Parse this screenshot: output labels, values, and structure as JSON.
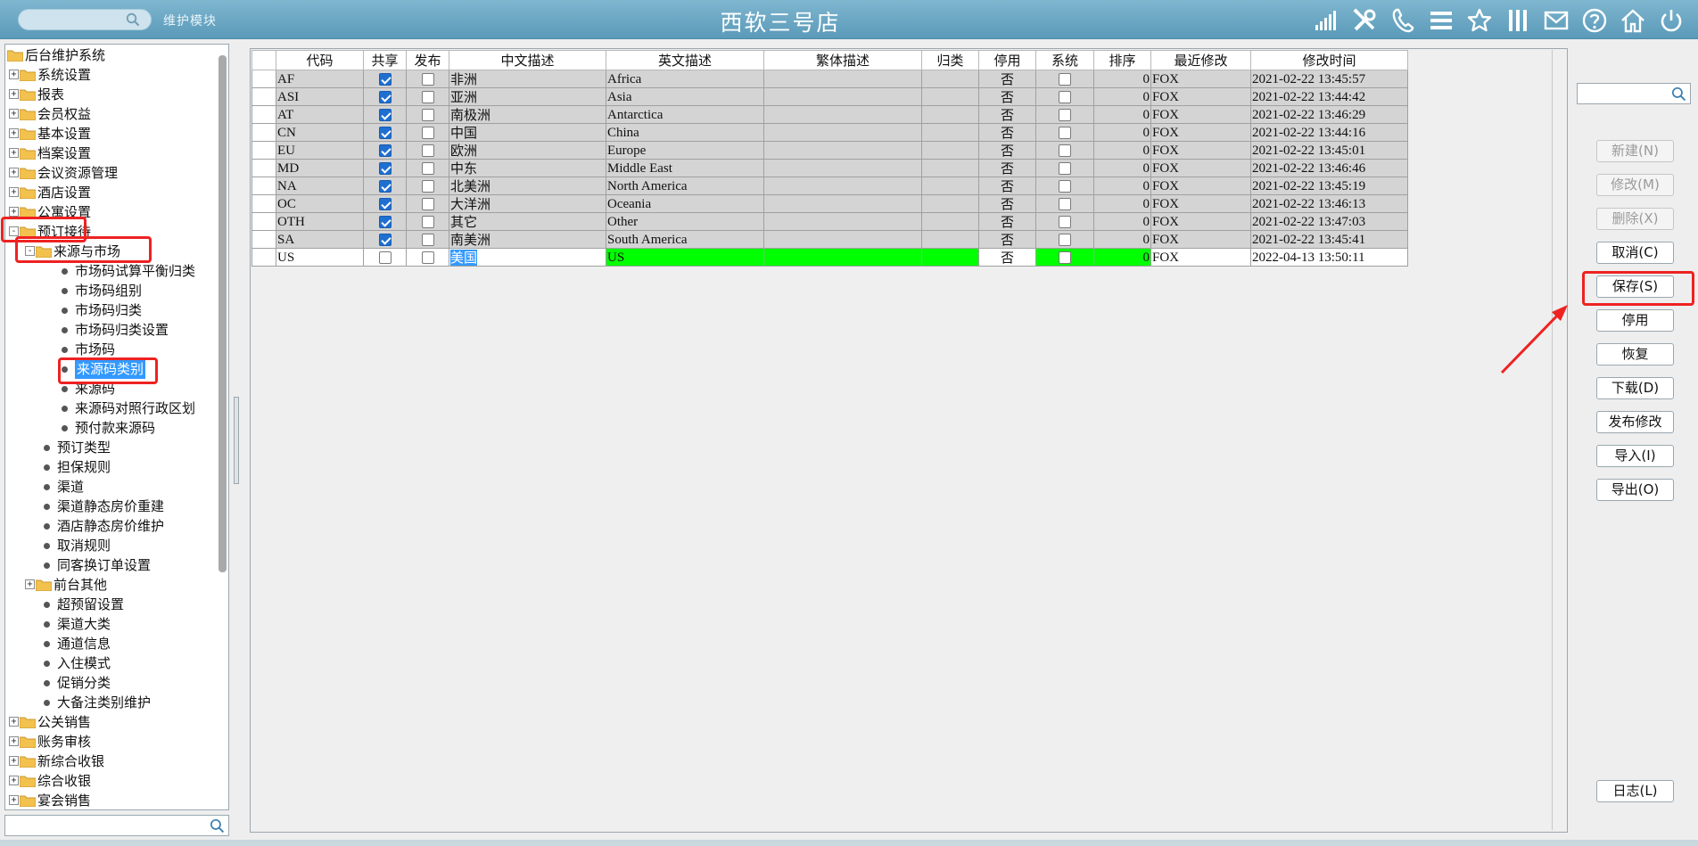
{
  "header": {
    "module_label": "维护模块",
    "title": "西软三号店",
    "icons": [
      "signal-icon",
      "tools-icon",
      "phone-icon",
      "menu-icon",
      "star-icon",
      "columns-icon",
      "mail-icon",
      "help-icon",
      "home-icon",
      "power-icon"
    ]
  },
  "tree": {
    "root": "后台维护系统",
    "items": [
      {
        "label": "系统设置",
        "kind": "folder",
        "level": 1,
        "state": "+"
      },
      {
        "label": "报表",
        "kind": "folder",
        "level": 1,
        "state": "+"
      },
      {
        "label": "会员权益",
        "kind": "folder",
        "level": 1,
        "state": "+"
      },
      {
        "label": "基本设置",
        "kind": "folder",
        "level": 1,
        "state": "+"
      },
      {
        "label": "档案设置",
        "kind": "folder",
        "level": 1,
        "state": "+"
      },
      {
        "label": "会议资源管理",
        "kind": "folder",
        "level": 1,
        "state": "+"
      },
      {
        "label": "酒店设置",
        "kind": "folder",
        "level": 1,
        "state": "+"
      },
      {
        "label": "公寓设置",
        "kind": "folder",
        "level": 1,
        "state": "+"
      },
      {
        "label": "预订接待",
        "kind": "folder",
        "level": 1,
        "state": "-"
      },
      {
        "label": "来源与市场",
        "kind": "folder",
        "level": 2,
        "state": "-"
      },
      {
        "label": "市场码试算平衡归类",
        "kind": "leaf",
        "level": 3
      },
      {
        "label": "市场码组别",
        "kind": "leaf",
        "level": 3
      },
      {
        "label": "市场码归类",
        "kind": "leaf",
        "level": 3
      },
      {
        "label": "市场码归类设置",
        "kind": "leaf",
        "level": 3
      },
      {
        "label": "市场码",
        "kind": "leaf",
        "level": 3
      },
      {
        "label": "来源码类别",
        "kind": "leaf",
        "level": 3,
        "selected": true
      },
      {
        "label": "来源码",
        "kind": "leaf",
        "level": 3
      },
      {
        "label": "来源码对照行政区划",
        "kind": "leaf",
        "level": 3
      },
      {
        "label": "预付款来源码",
        "kind": "leaf",
        "level": 3
      },
      {
        "label": "预订类型",
        "kind": "leaf",
        "level": 2
      },
      {
        "label": "担保规则",
        "kind": "leaf",
        "level": 2
      },
      {
        "label": "渠道",
        "kind": "leaf",
        "level": 2
      },
      {
        "label": "渠道静态房价重建",
        "kind": "leaf",
        "level": 2
      },
      {
        "label": "酒店静态房价维护",
        "kind": "leaf",
        "level": 2
      },
      {
        "label": "取消规则",
        "kind": "leaf",
        "level": 2
      },
      {
        "label": "同客换订单设置",
        "kind": "leaf",
        "level": 2
      },
      {
        "label": "前台其他",
        "kind": "folder",
        "level": 2,
        "state": "+"
      },
      {
        "label": "超预留设置",
        "kind": "leaf",
        "level": 2
      },
      {
        "label": "渠道大类",
        "kind": "leaf",
        "level": 2
      },
      {
        "label": "通道信息",
        "kind": "leaf",
        "level": 2
      },
      {
        "label": "入住模式",
        "kind": "leaf",
        "level": 2
      },
      {
        "label": "促销分类",
        "kind": "leaf",
        "level": 2
      },
      {
        "label": "大备注类别维护",
        "kind": "leaf",
        "level": 2
      },
      {
        "label": "公关销售",
        "kind": "folder",
        "level": 1,
        "state": "+"
      },
      {
        "label": "账务审核",
        "kind": "folder",
        "level": 1,
        "state": "+"
      },
      {
        "label": "新综合收银",
        "kind": "folder",
        "level": 1,
        "state": "+"
      },
      {
        "label": "综合收银",
        "kind": "folder",
        "level": 1,
        "state": "+"
      },
      {
        "label": "宴会销售",
        "kind": "folder",
        "level": 1,
        "state": "+"
      }
    ]
  },
  "grid": {
    "columns": [
      "代码",
      "共享",
      "发布",
      "中文描述",
      "英文描述",
      "繁体描述",
      "归类",
      "停用",
      "系统",
      "排序",
      "最近修改",
      "修改时间"
    ],
    "rows": [
      {
        "code": "AF",
        "shared": true,
        "publish": false,
        "cn": "非洲",
        "en": "Africa",
        "tw": "",
        "cat": "",
        "disabled": "否",
        "system": false,
        "sort": "0",
        "modifier": "FOX",
        "time": "2021-02-22 13:45:57"
      },
      {
        "code": "ASI",
        "shared": true,
        "publish": false,
        "cn": "亚洲",
        "en": "Asia",
        "tw": "",
        "cat": "",
        "disabled": "否",
        "system": false,
        "sort": "0",
        "modifier": "FOX",
        "time": "2021-02-22 13:44:42"
      },
      {
        "code": "AT",
        "shared": true,
        "publish": false,
        "cn": "南极洲",
        "en": "Antarctica",
        "tw": "",
        "cat": "",
        "disabled": "否",
        "system": false,
        "sort": "0",
        "modifier": "FOX",
        "time": "2021-02-22 13:46:29"
      },
      {
        "code": "CN",
        "shared": true,
        "publish": false,
        "cn": "中国",
        "en": "China",
        "tw": "",
        "cat": "",
        "disabled": "否",
        "system": false,
        "sort": "0",
        "modifier": "FOX",
        "time": "2021-02-22 13:44:16"
      },
      {
        "code": "EU",
        "shared": true,
        "publish": false,
        "cn": "欧洲",
        "en": "Europe",
        "tw": "",
        "cat": "",
        "disabled": "否",
        "system": false,
        "sort": "0",
        "modifier": "FOX",
        "time": "2021-02-22 13:45:01"
      },
      {
        "code": "MD",
        "shared": true,
        "publish": false,
        "cn": "中东",
        "en": "Middle East",
        "tw": "",
        "cat": "",
        "disabled": "否",
        "system": false,
        "sort": "0",
        "modifier": "FOX",
        "time": "2021-02-22 13:46:46"
      },
      {
        "code": "NA",
        "shared": true,
        "publish": false,
        "cn": "北美洲",
        "en": "North America",
        "tw": "",
        "cat": "",
        "disabled": "否",
        "system": false,
        "sort": "0",
        "modifier": "FOX",
        "time": "2021-02-22 13:45:19"
      },
      {
        "code": "OC",
        "shared": true,
        "publish": false,
        "cn": "大洋洲",
        "en": "Oceania",
        "tw": "",
        "cat": "",
        "disabled": "否",
        "system": false,
        "sort": "0",
        "modifier": "FOX",
        "time": "2021-02-22 13:46:13"
      },
      {
        "code": "OTH",
        "shared": true,
        "publish": false,
        "cn": "其它",
        "en": "Other",
        "tw": "",
        "cat": "",
        "disabled": "否",
        "system": false,
        "sort": "0",
        "modifier": "FOX",
        "time": "2021-02-22 13:47:03"
      },
      {
        "code": "SA",
        "shared": true,
        "publish": false,
        "cn": "南美洲",
        "en": "South America",
        "tw": "",
        "cat": "",
        "disabled": "否",
        "system": false,
        "sort": "0",
        "modifier": "FOX",
        "time": "2021-02-22 13:45:41"
      },
      {
        "code": "US",
        "shared": false,
        "publish": false,
        "cn": "美国",
        "en": "US",
        "tw": "",
        "cat": "",
        "disabled": "否",
        "system": false,
        "sort": "0",
        "modifier": "FOX",
        "time": "2022-04-13 13:50:11",
        "editing": true
      }
    ]
  },
  "actions": {
    "buttons": [
      {
        "label": "新建(N)",
        "enabled": false
      },
      {
        "label": "修改(M)",
        "enabled": false
      },
      {
        "label": "删除(X)",
        "enabled": false
      },
      {
        "label": "取消(C)",
        "enabled": true
      },
      {
        "label": "保存(S)",
        "enabled": true
      },
      {
        "label": "停用",
        "enabled": true
      },
      {
        "label": "恢复",
        "enabled": true
      },
      {
        "label": "下载(D)",
        "enabled": true
      },
      {
        "label": "发布修改",
        "enabled": true
      },
      {
        "label": "导入(I)",
        "enabled": true
      },
      {
        "label": "导出(O)",
        "enabled": true
      }
    ],
    "log_button": "日志(L)"
  },
  "colors": {
    "header_bar": "#6aa6c3",
    "highlight_red": "#ee2222",
    "selection_blue": "#3399ff",
    "edit_green": "#00ff00",
    "checkbox_blue": "#1f6fd1"
  }
}
